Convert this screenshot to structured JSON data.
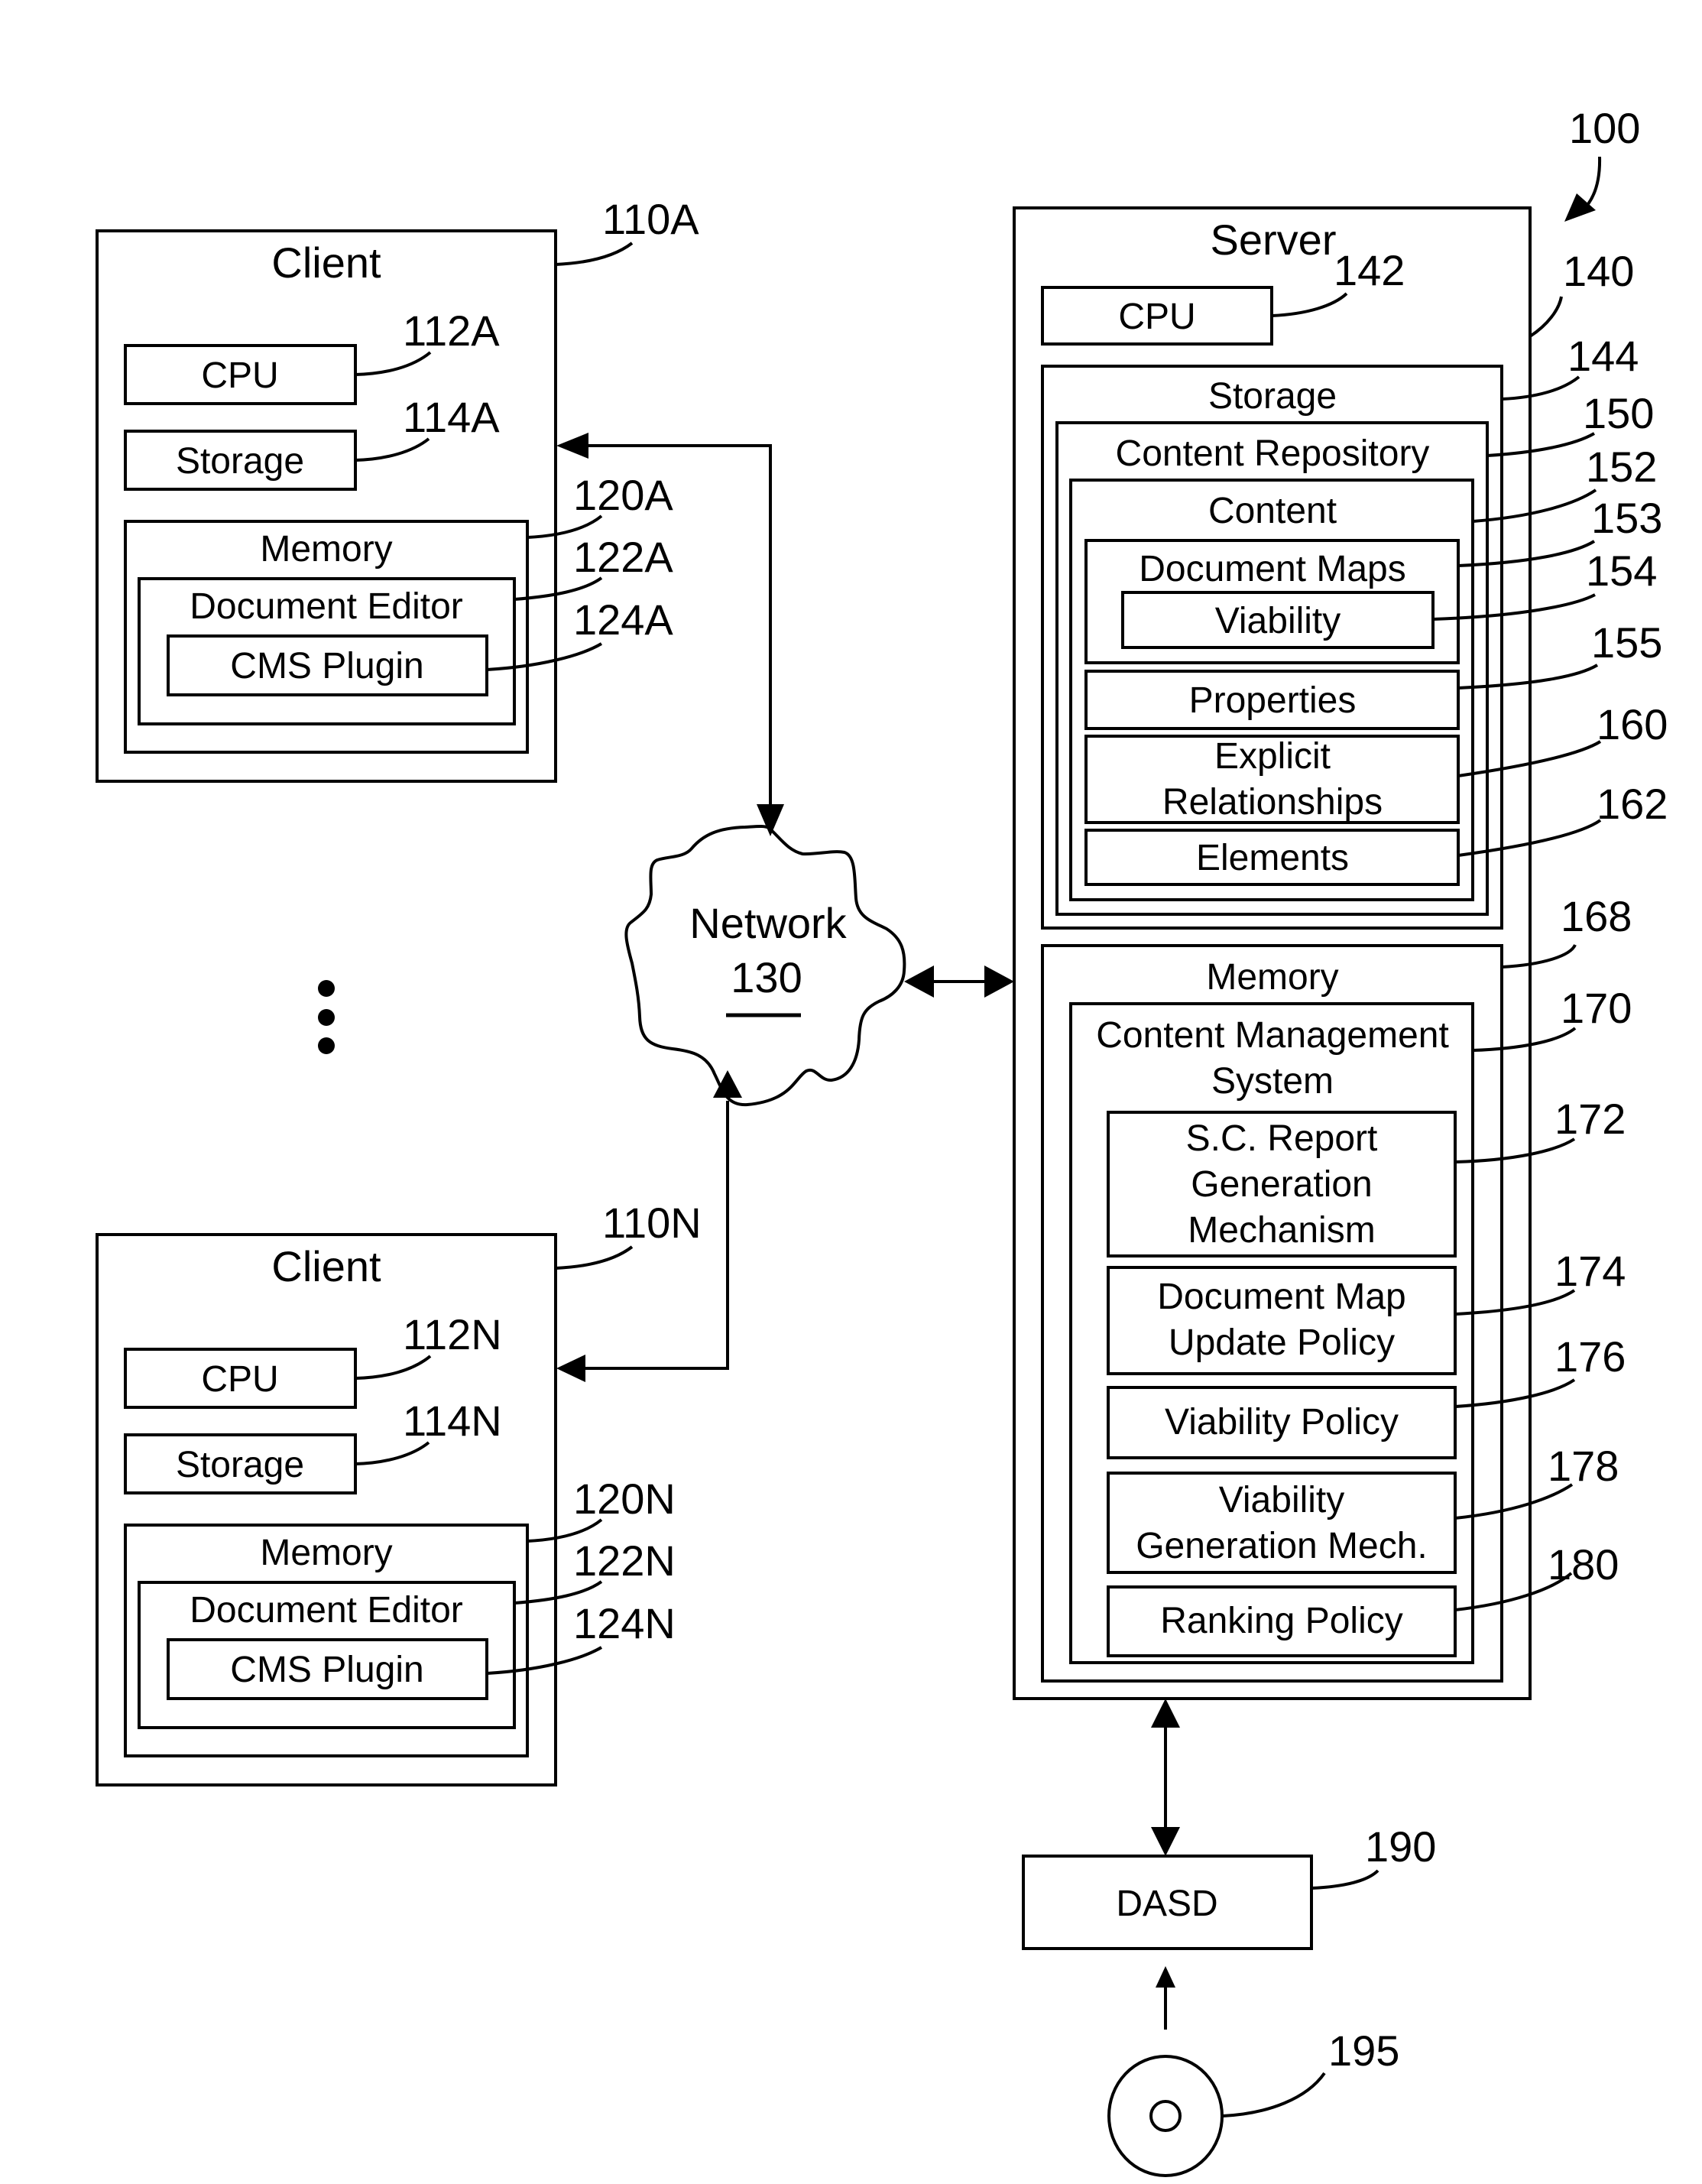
{
  "figure": {
    "system_ref": "100",
    "colors": {
      "line": "#000000",
      "background": "#ffffff"
    }
  },
  "clients": [
    {
      "ref": "110A",
      "title": "Client",
      "cpu": {
        "label": "CPU",
        "ref": "112A"
      },
      "storage": {
        "label": "Storage",
        "ref": "114A"
      },
      "memory": {
        "label": "Memory",
        "ref": "120A"
      },
      "document_editor": {
        "label": "Document Editor",
        "ref": "122A"
      },
      "cms_plugin": {
        "label": "CMS Plugin",
        "ref": "124A"
      }
    },
    {
      "ref": "110N",
      "title": "Client",
      "cpu": {
        "label": "CPU",
        "ref": "112N"
      },
      "storage": {
        "label": "Storage",
        "ref": "114N"
      },
      "memory": {
        "label": "Memory",
        "ref": "120N"
      },
      "document_editor": {
        "label": "Document Editor",
        "ref": "122N"
      },
      "cms_plugin": {
        "label": "CMS Plugin",
        "ref": "124N"
      }
    }
  ],
  "ellipsis_icon": "vertical-ellipsis",
  "network": {
    "label": "Network",
    "ref": "130"
  },
  "server": {
    "title": "Server",
    "ref": "140",
    "cpu": {
      "label": "CPU",
      "ref": "142"
    },
    "storage": {
      "label": "Storage",
      "ref": "144",
      "content_repository": {
        "label": "Content Repository",
        "ref": "150",
        "content": {
          "label": "Content",
          "ref": "152",
          "document_maps": {
            "label": "Document Maps",
            "ref": "153"
          },
          "viability": {
            "label": "Viability",
            "ref": "154"
          },
          "properties": {
            "label": "Properties",
            "ref": "155"
          },
          "explicit_relationships": {
            "line1": "Explicit",
            "line2": "Relationships",
            "ref": "160"
          },
          "elements": {
            "label": "Elements",
            "ref": "162"
          }
        }
      }
    },
    "memory": {
      "label": "Memory",
      "ref": "168",
      "cms": {
        "line1": "Content Management",
        "line2": "System",
        "ref": "170",
        "sc_report": {
          "line1": "S.C. Report",
          "line2": "Generation",
          "line3": "Mechanism",
          "ref": "172"
        },
        "doc_map_update_policy": {
          "line1": "Document Map",
          "line2": "Update Policy",
          "ref": "174"
        },
        "viability_policy": {
          "label": "Viability Policy",
          "ref": "176"
        },
        "viability_generation": {
          "line1": "Viability",
          "line2": "Generation Mech.",
          "ref": "178"
        },
        "ranking_policy": {
          "label": "Ranking Policy",
          "ref": "180"
        }
      }
    }
  },
  "dasd": {
    "label": "DASD",
    "ref": "190"
  },
  "media": {
    "icon": "disc",
    "ref": "195"
  }
}
